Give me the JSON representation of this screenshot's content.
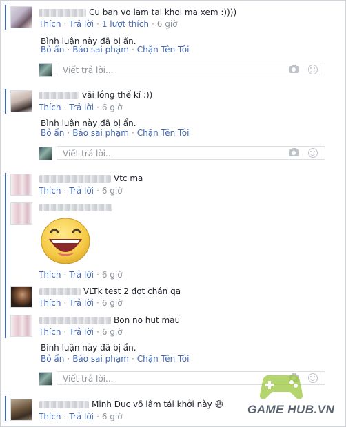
{
  "comments": [
    {
      "author_blurred": "ゝゝ Nguyễn",
      "text": "Cu ban vo lam tai khoi ma xem :))))",
      "actions": {
        "like": "Thích",
        "reply": "Trả lời",
        "likes_count": "1 lượt thích",
        "time": "6 giờ"
      },
      "hidden": {
        "notice": "Bình luận này đã bị ẩn.",
        "unhide": "Bỏ ẩn",
        "report": "Báo sai phạm",
        "block": "Chặn Tên Tôi"
      },
      "reply_placeholder": "Viết trả lời..."
    },
    {
      "author_blurred": "",
      "text": "vãi lồng thế kỉ :))",
      "actions": {
        "like": "Thích",
        "reply": "Trả lời",
        "time": "6 giờ"
      },
      "hidden": {
        "notice": "Bình luận này đã bị ẩn.",
        "unhide": "Bỏ ẩn",
        "report": "Báo sai phạm",
        "block": "Chặn Tên Tôi"
      },
      "reply_placeholder": "Viết trả lời..."
    },
    {
      "author_blurred": "",
      "text": "Vtc ma",
      "actions": {
        "like": "Thích",
        "reply": "Trả lời",
        "time": "6 giờ"
      }
    },
    {
      "author_blurred": "",
      "text": "",
      "sticker": "laughing-face-sticker",
      "actions": {
        "like": "Thích",
        "reply": "Trả lời",
        "time": "6 giờ"
      }
    },
    {
      "author_blurred": "",
      "text": "VLTk test 2 đợt chán qa",
      "actions": {
        "like": "Thích",
        "reply": "Trả lời",
        "time": "6 giờ"
      }
    },
    {
      "author_blurred": "guyễn Quy",
      "text": "Bon no hut mau",
      "actions": {
        "like": "Thích",
        "reply": "Trả lời",
        "time": "6 giờ"
      },
      "hidden": {
        "notice": "Bình luận này đã bị ẩn.",
        "unhide": "Bỏ ẩn",
        "report": "Báo sai phạm",
        "block": "Chặn Tên Tôi"
      },
      "reply_placeholder": "Viết trả lời..."
    },
    {
      "author_blurred": "",
      "text": "Minh Duc võ lâm tái khởi này 😆",
      "actions": {
        "like": "Thích",
        "reply": "Trả lời",
        "time": "6 giờ"
      }
    }
  ],
  "watermark": "GAME HUB.VN",
  "colors": {
    "link": "#4267b2",
    "meta": "#90949c",
    "thread_bar": "#4267b2"
  }
}
